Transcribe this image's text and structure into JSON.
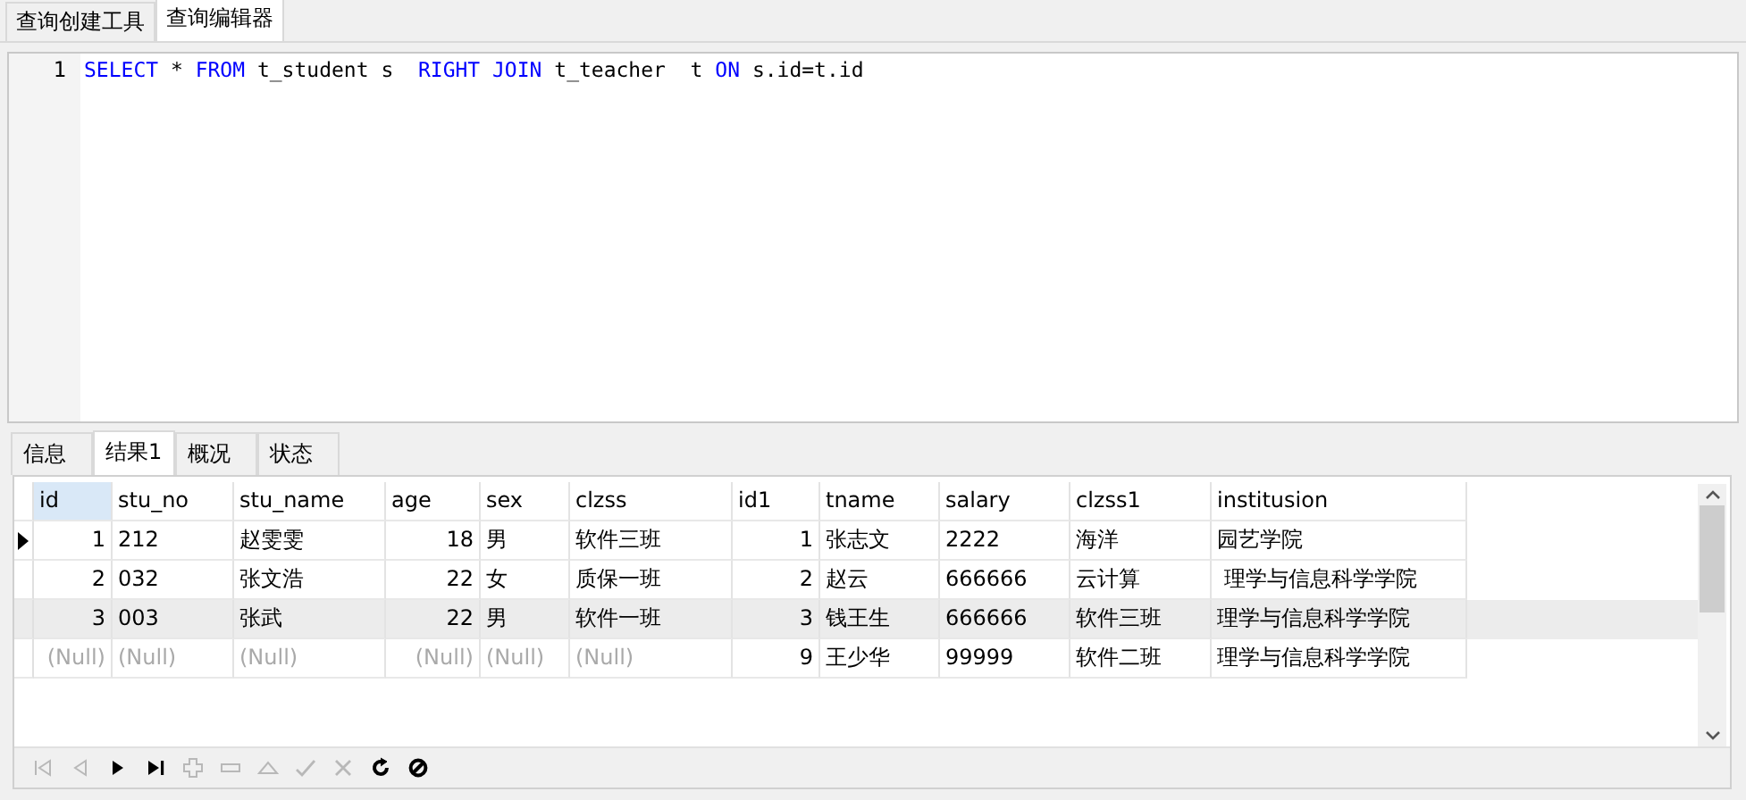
{
  "top_tabs": [
    {
      "label": "查询创建工具",
      "selected": false
    },
    {
      "label": "查询编辑器",
      "selected": true
    }
  ],
  "editor": {
    "lines": [
      {
        "number": "1",
        "tokens": [
          {
            "text": "SELECT",
            "kind": "keyword"
          },
          {
            "text": " * ",
            "kind": "plain"
          },
          {
            "text": "FROM",
            "kind": "keyword"
          },
          {
            "text": " t_student s  ",
            "kind": "plain"
          },
          {
            "text": "RIGHT JOIN",
            "kind": "keyword"
          },
          {
            "text": " t_teacher  t ",
            "kind": "plain"
          },
          {
            "text": "ON",
            "kind": "keyword"
          },
          {
            "text": " s.id=t.id",
            "kind": "plain"
          }
        ]
      }
    ]
  },
  "result_tabs": [
    {
      "label": "信息",
      "selected": false
    },
    {
      "label": "结果1",
      "selected": true
    },
    {
      "label": "概况",
      "selected": false
    },
    {
      "label": "状态",
      "selected": false
    }
  ],
  "table": {
    "columns": [
      {
        "name": "id",
        "numeric": true,
        "selected": true
      },
      {
        "name": "stu_no",
        "numeric": false,
        "selected": false
      },
      {
        "name": "stu_name",
        "numeric": false,
        "selected": false
      },
      {
        "name": "age",
        "numeric": true,
        "selected": false
      },
      {
        "name": "sex",
        "numeric": false,
        "selected": false
      },
      {
        "name": "clzss",
        "numeric": false,
        "selected": false
      },
      {
        "name": "id1",
        "numeric": true,
        "selected": false
      },
      {
        "name": "tname",
        "numeric": false,
        "selected": false
      },
      {
        "name": "salary",
        "numeric": false,
        "selected": false
      },
      {
        "name": "clzss1",
        "numeric": false,
        "selected": false
      },
      {
        "name": "institusion",
        "numeric": false,
        "selected": false
      }
    ],
    "rows": [
      {
        "selected": true,
        "highlighted": false,
        "cells": [
          {
            "text": "1",
            "null": false
          },
          {
            "text": "212",
            "null": false
          },
          {
            "text": "赵雯雯",
            "null": false
          },
          {
            "text": "18",
            "null": false
          },
          {
            "text": "男",
            "null": false
          },
          {
            "text": "软件三班",
            "null": false
          },
          {
            "text": "1",
            "null": false
          },
          {
            "text": "张志文",
            "null": false
          },
          {
            "text": "2222",
            "null": false
          },
          {
            "text": "海洋",
            "null": false
          },
          {
            "text": "园艺学院",
            "null": false
          }
        ]
      },
      {
        "selected": false,
        "highlighted": false,
        "cells": [
          {
            "text": "2",
            "null": false
          },
          {
            "text": "032",
            "null": false
          },
          {
            "text": "张文浩",
            "null": false
          },
          {
            "text": "22",
            "null": false
          },
          {
            "text": "女",
            "null": false
          },
          {
            "text": "质保一班",
            "null": false
          },
          {
            "text": "2",
            "null": false
          },
          {
            "text": "赵云",
            "null": false
          },
          {
            "text": "666666",
            "null": false
          },
          {
            "text": "云计算",
            "null": false
          },
          {
            "text": " 理学与信息科学学院",
            "null": false
          }
        ]
      },
      {
        "selected": false,
        "highlighted": true,
        "cells": [
          {
            "text": "3",
            "null": false
          },
          {
            "text": "003",
            "null": false
          },
          {
            "text": "张武",
            "null": false
          },
          {
            "text": "22",
            "null": false
          },
          {
            "text": "男",
            "null": false
          },
          {
            "text": "软件一班",
            "null": false
          },
          {
            "text": "3",
            "null": false
          },
          {
            "text": "钱王生",
            "null": false
          },
          {
            "text": "666666",
            "null": false
          },
          {
            "text": "软件三班",
            "null": false
          },
          {
            "text": "理学与信息科学学院",
            "null": false
          }
        ]
      },
      {
        "selected": false,
        "highlighted": false,
        "cells": [
          {
            "text": "(Null)",
            "null": true
          },
          {
            "text": "(Null)",
            "null": true
          },
          {
            "text": "(Null)",
            "null": true
          },
          {
            "text": "(Null)",
            "null": true
          },
          {
            "text": "(Null)",
            "null": true
          },
          {
            "text": "(Null)",
            "null": true
          },
          {
            "text": "9",
            "null": false
          },
          {
            "text": "王少华",
            "null": false
          },
          {
            "text": "99999",
            "null": false
          },
          {
            "text": "软件二班",
            "null": false
          },
          {
            "text": "理学与信息科学学院",
            "null": false
          }
        ]
      }
    ]
  },
  "nav_toolbar": [
    {
      "kind": "first",
      "disabled": true
    },
    {
      "kind": "prev",
      "disabled": true
    },
    {
      "kind": "next",
      "disabled": false
    },
    {
      "kind": "last",
      "disabled": false
    },
    {
      "kind": "add",
      "disabled": true
    },
    {
      "kind": "delete",
      "disabled": true
    },
    {
      "kind": "apply",
      "disabled": true
    },
    {
      "kind": "confirm",
      "disabled": true
    },
    {
      "kind": "cancel",
      "disabled": true
    },
    {
      "kind": "refresh",
      "disabled": false
    },
    {
      "kind": "stop",
      "disabled": false
    }
  ]
}
